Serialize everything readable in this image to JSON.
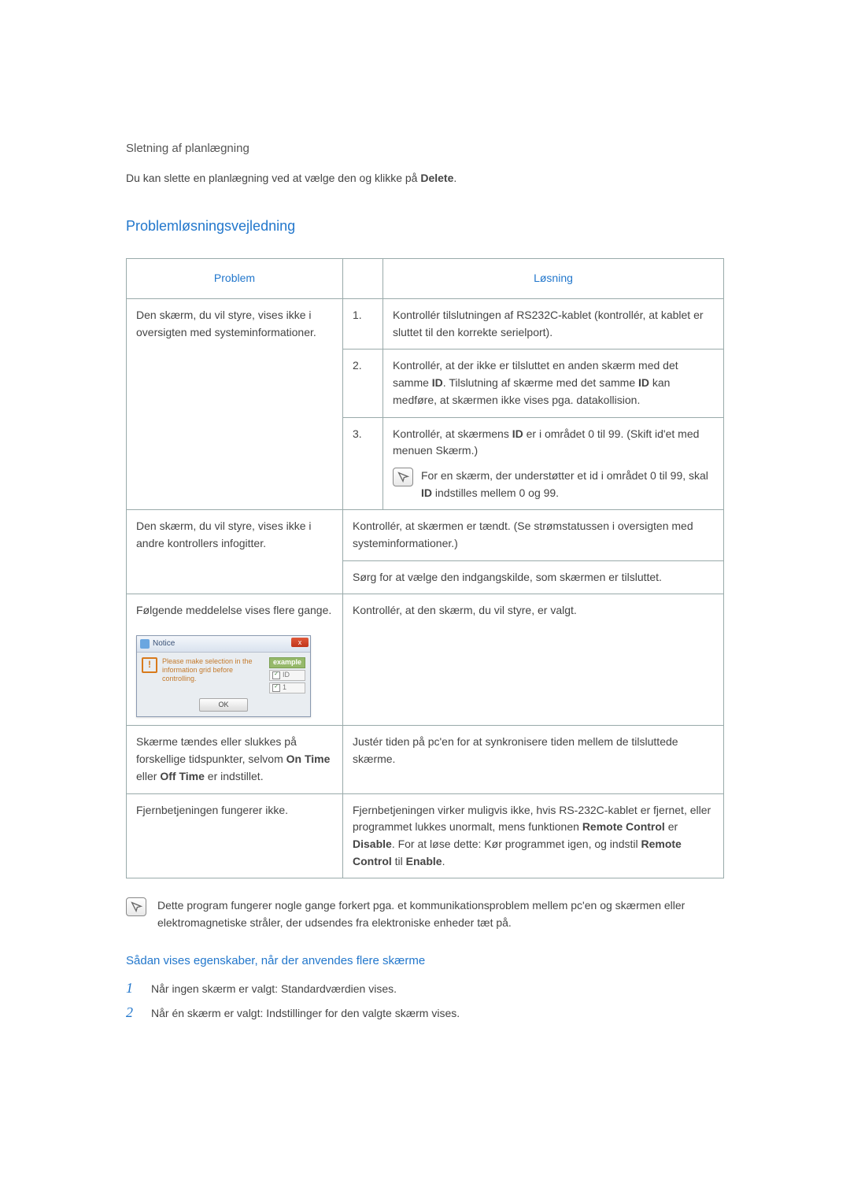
{
  "intro": {
    "subheading": "Sletning af planlægning",
    "paragraph_before_bold": "Du kan slette en planlægning ved at vælge den og klikke på ",
    "paragraph_bold": "Delete",
    "paragraph_after_bold": "."
  },
  "section_title": "Problemløsningsvejledning",
  "table": {
    "header_problem": "Problem",
    "header_solution": "Løsning",
    "row1": {
      "problem": "Den skærm, du vil styre, vises ikke i oversigten med systeminformationer.",
      "s1_num": "1.",
      "s1": "Kontrollér tilslutningen af RS232C-kablet (kontrollér, at kablet er sluttet til den korrekte serielport).",
      "s2_num": "2.",
      "s2_a": "Kontrollér, at der ikke er tilsluttet en anden skærm med det samme ",
      "s2_b1": "ID",
      "s2_c": ". Tilslutning af skærme med det samme ",
      "s2_b2": "ID",
      "s2_d": " kan medføre, at skærmen ikke vises pga. datakollision.",
      "s3_num": "3.",
      "s3_a": "Kontrollér, at skærmens ",
      "s3_b": "ID",
      "s3_c": " er i området 0 til 99. (Skift id'et med menuen Skærm.)",
      "s3_note_a": "For en skærm, der understøtter et id i området 0 til 99, skal ",
      "s3_note_b": "ID",
      "s3_note_c": " indstilles mellem 0 og 99."
    },
    "row2": {
      "problem": "Den skærm, du vil styre, vises ikke i andre kontrollers infogitter.",
      "s1": "Kontrollér, at skærmen er tændt. (Se strømstatussen i oversigten med systeminformationer.)",
      "s2": "Sørg for at vælge den indgangskilde, som skærmen er tilsluttet."
    },
    "row3": {
      "problem": "Følgende meddelelse vises flere gange.",
      "solution": "Kontrollér, at den skærm, du vil styre, er valgt.",
      "dialog": {
        "title": "Notice",
        "msg": "Please make selection in the information grid before controlling.",
        "example": "example",
        "id": "ID",
        "one": "1",
        "ok": "OK"
      }
    },
    "row4": {
      "problem_a": "Skærme tændes eller slukkes på forskellige tidspunkter, selvom ",
      "problem_b1": "On Time",
      "problem_mid": " eller ",
      "problem_b2": "Off Time",
      "problem_c": " er indstillet.",
      "solution": "Justér tiden på pc'en for at synkronisere tiden mellem de tilsluttede skærme."
    },
    "row5": {
      "problem": "Fjernbetjeningen fungerer ikke.",
      "solution_a": "Fjernbetjeningen virker muligvis ikke, hvis RS-232C-kablet er fjernet, eller programmet lukkes unormalt, mens funktionen ",
      "solution_b1": "Remote Control",
      "solution_mid1": " er ",
      "solution_b2": "Disable",
      "solution_mid2": ". For at løse dette: Kør programmet igen, og indstil ",
      "solution_b3": "Remote Control",
      "solution_mid3": " til ",
      "solution_b4": "Enable",
      "solution_end": "."
    }
  },
  "footer_note": "Dette program fungerer nogle gange forkert pga. et kommunikationsproblem mellem pc'en og skærmen eller elektromagnetiske stråler, der udsendes fra elektroniske enheder tæt på.",
  "sub_section_title": "Sådan vises egenskaber, når der anvendes flere skærme",
  "list": {
    "n1": "1",
    "t1": "Når ingen skærm er valgt: Standardværdien vises.",
    "n2": "2",
    "t2": "Når én skærm er valgt: Indstillinger for den valgte skærm vises."
  }
}
